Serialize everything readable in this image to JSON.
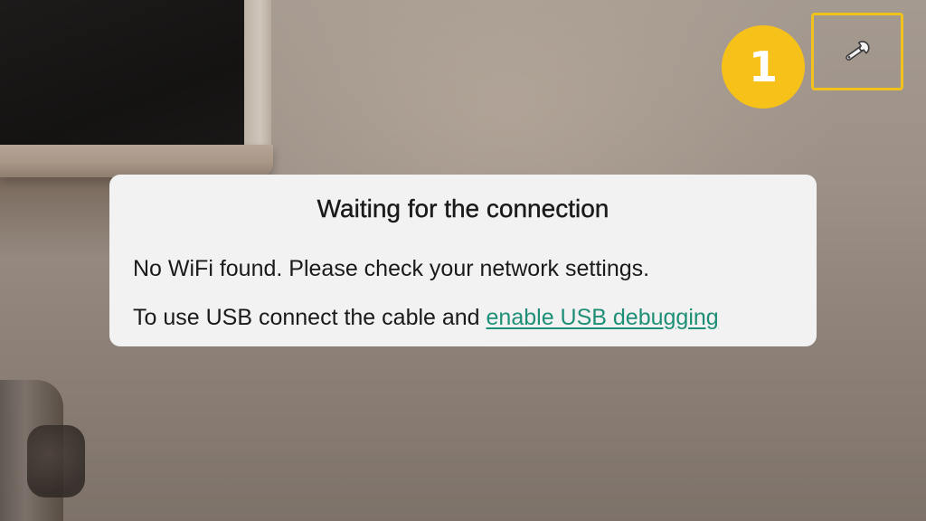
{
  "status_badge": {
    "number": "1",
    "color": "#f6c21a"
  },
  "settings_button": {
    "icon": "wrench-icon",
    "border_color": "#f1c21c"
  },
  "dialog": {
    "title": "Waiting for the connection",
    "wifi_message": "No WiFi found. Please check your network settings.",
    "usb_message_prefix": "To use USB connect the cable and ",
    "usb_link_label": "enable USB debugging",
    "link_color": "#1e8f76"
  }
}
